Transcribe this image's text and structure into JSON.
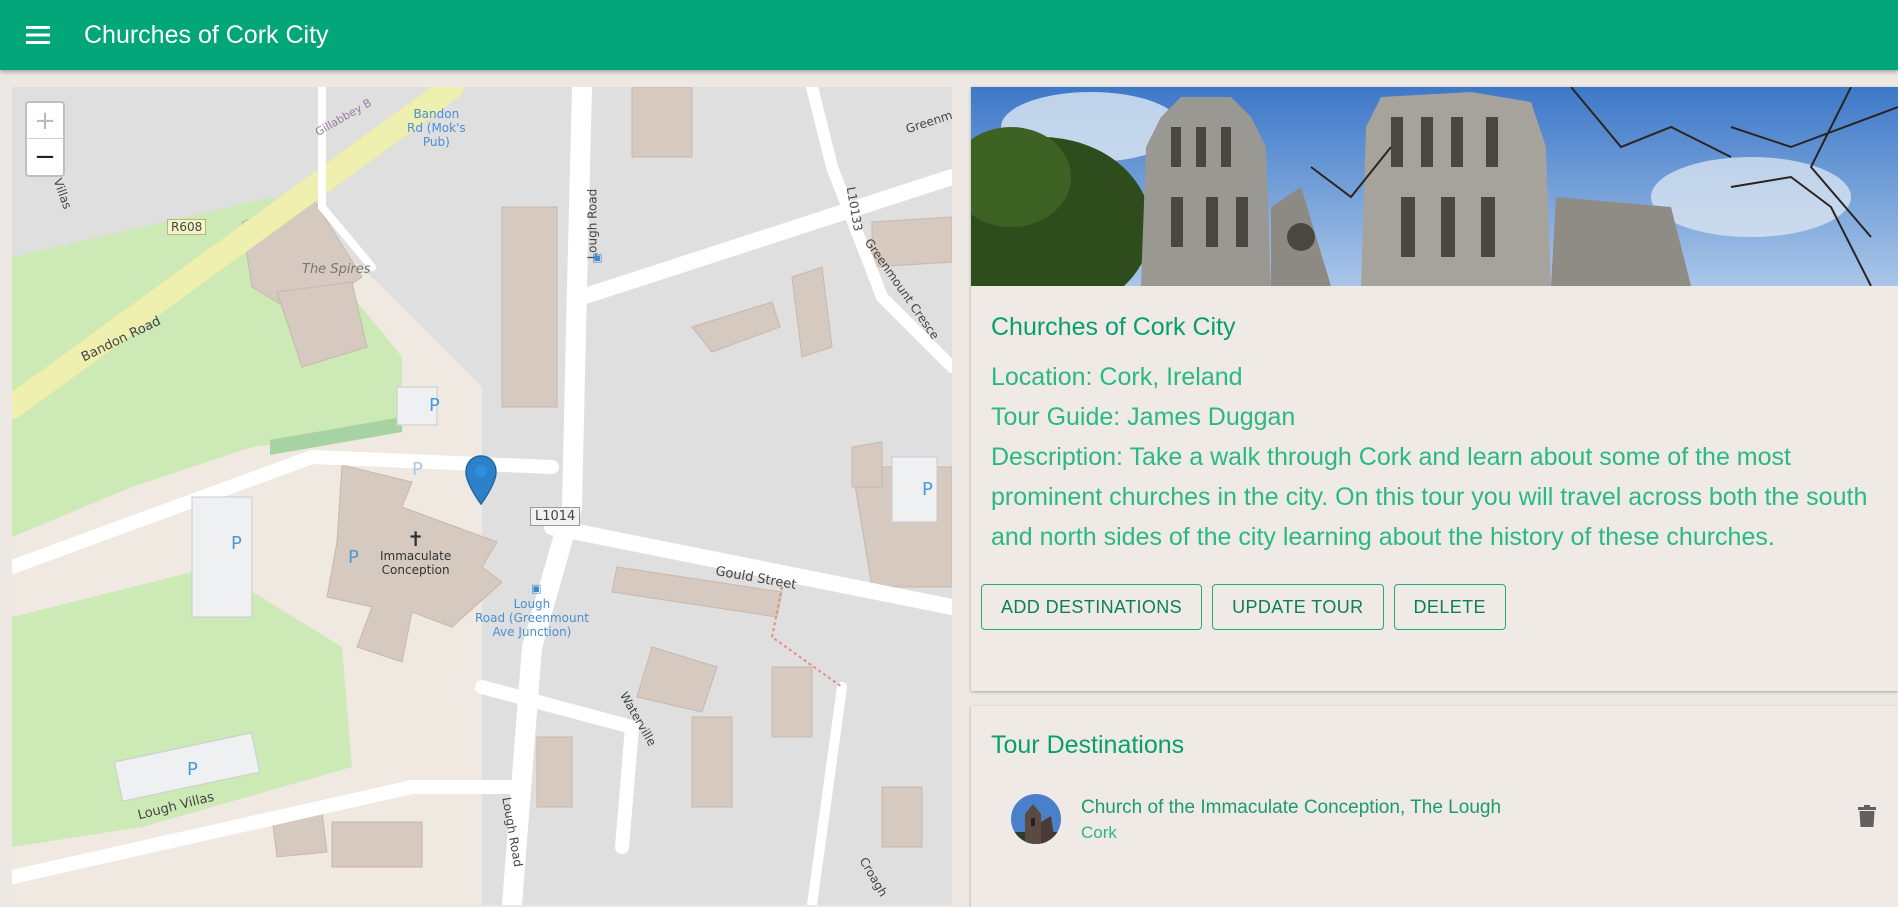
{
  "appbar": {
    "title": "Churches of Cork City",
    "menu_icon": "menu-icon",
    "color": "#03a678"
  },
  "map": {
    "zoom_in_label": "+",
    "zoom_out_label": "−",
    "labels": {
      "bandon_road": "Bandon Road",
      "r608": "R608",
      "villas": "s Villas",
      "gillabbey": "Gillabbey B",
      "bus_stop_1": [
        "Bandon",
        "Rd (Mok's",
        "Pub)"
      ],
      "spires": "The Spires",
      "lough_road_top": "Lough Road",
      "l10133": "L10133",
      "greenmount_crescent": "Greenmount Cresce",
      "greenm": "Greenm",
      "church": [
        "Immaculate",
        "Conception"
      ],
      "l1014": "L1014",
      "gould_street": "Gould Street",
      "bus_stop_2": [
        "Lough",
        "Road (Greenmount",
        "Ave Junction)"
      ],
      "waterville": "Waterville",
      "lough_road_bottom": "Lough Road",
      "lough_villas": "Lough Villas",
      "croagh": "Croagh",
      "parking": "P"
    }
  },
  "tour": {
    "title": "Churches of Cork City",
    "location": "Location: Cork, Ireland",
    "guide": "Tour Guide: James Duggan",
    "description": "Description: Take a walk through Cork and learn about some of the most prominent churches in the city. On this tour you will travel across both the south and north sides of the city learning about the history of these churches.",
    "buttons": {
      "add": "ADD DESTINATIONS",
      "update": "UPDATE TOUR",
      "delete": "DELETE"
    }
  },
  "destinations": {
    "title": "Tour Destinations",
    "items": [
      {
        "name": "Church of the Immaculate Conception, The Lough",
        "city": "Cork",
        "icon": "trash-icon"
      }
    ]
  }
}
